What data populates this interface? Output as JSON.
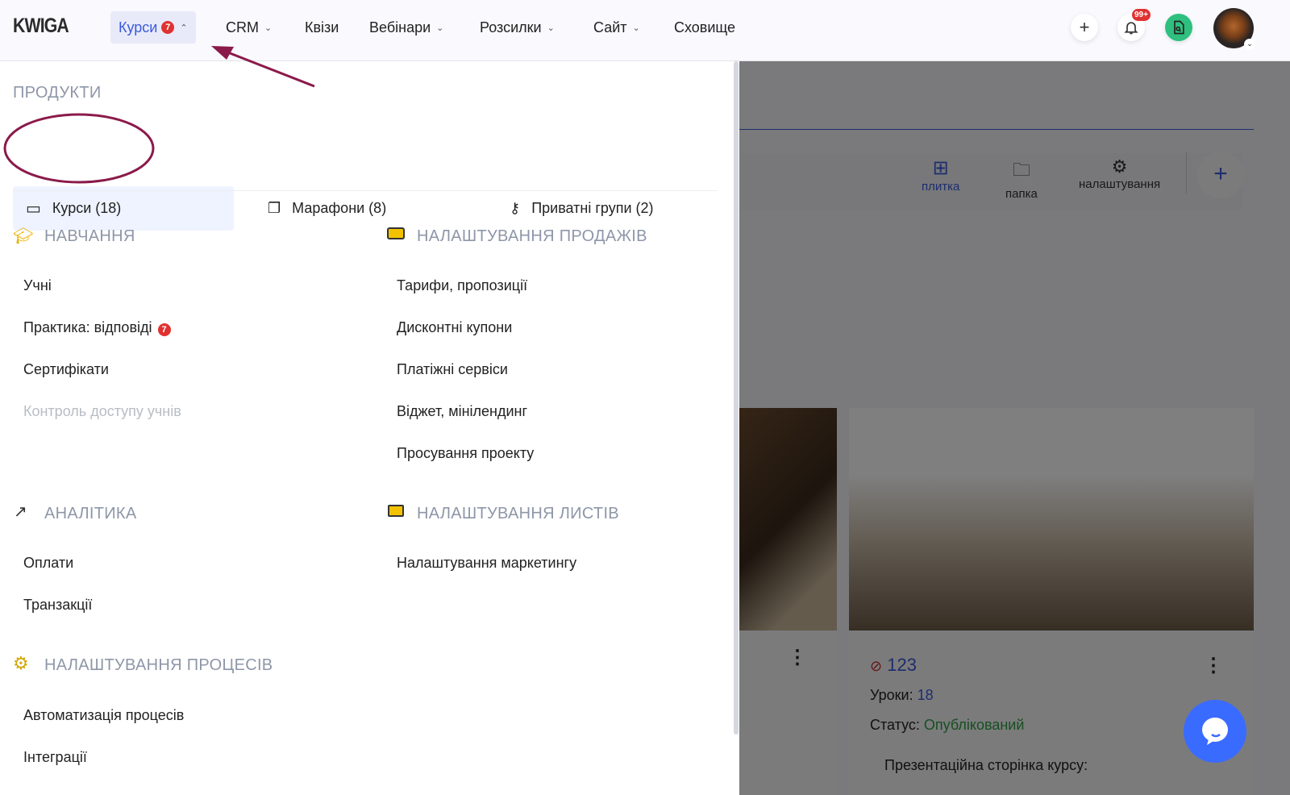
{
  "header": {
    "logo": "KWIGA",
    "nav": [
      {
        "label": "Курси",
        "badge": "7"
      },
      {
        "label": "CRM"
      },
      {
        "label": "Квізи"
      },
      {
        "label": "Вебінари"
      },
      {
        "label": "Розсилки"
      },
      {
        "label": "Сайт"
      },
      {
        "label": "Сховище"
      }
    ],
    "notifications_badge": "99+"
  },
  "menu": {
    "products_title": "ПРОДУКТИ",
    "products": [
      {
        "label": "Курси (18)",
        "icon": "video-icon"
      },
      {
        "label": "Марафони (8)",
        "icon": "stack-icon"
      },
      {
        "label": "Приватні групи (2)",
        "icon": "key-icon"
      }
    ],
    "learning": {
      "title": "НАВЧАННЯ",
      "items": [
        "Учні",
        "Практика: відповіді",
        "Сертифікати",
        "Контроль доступу учнів"
      ],
      "practice_badge": "7"
    },
    "sales": {
      "title": "НАЛАШТУВАННЯ ПРОДАЖІВ",
      "items": [
        "Тарифи, пропозиції",
        "Дисконтні купони",
        "Платіжні сервіси",
        "Віджет, мінілендинг",
        "Просування проекту"
      ]
    },
    "analytics": {
      "title": "АНАЛІТИКА",
      "items": [
        "Оплати",
        "Транзакції"
      ]
    },
    "letters": {
      "title": "НАЛАШТУВАННЯ ЛИСТІВ",
      "items": [
        "Налаштування маркетингу"
      ]
    },
    "processes": {
      "title": "НАЛАШТУВАННЯ ПРОЦЕСІВ",
      "items": [
        "Автоматизація процесів",
        "Інтеграції"
      ]
    }
  },
  "toolbar": {
    "tile": "плитка",
    "folder": "папка",
    "settings": "налаштування"
  },
  "card": {
    "title": "123",
    "lessons_label": "Уроки:",
    "lessons": "18",
    "status_label": "Статус:",
    "status": "Опублікований",
    "presentation": "Презентаційна сторінка курсу:"
  },
  "colors": {
    "accent": "#3b5bdb",
    "annotation": "#8b1a4a",
    "chat": "#3a6bff"
  }
}
